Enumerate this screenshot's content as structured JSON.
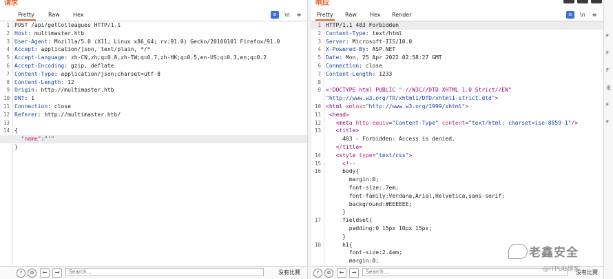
{
  "request": {
    "title": "请求",
    "tabs": [
      "Pretty",
      "Raw",
      "Hex"
    ],
    "toolbar_icons": [
      "≡",
      "\\n",
      "≡"
    ],
    "lines": [
      {
        "n": "1",
        "parts": [
          [
            "tx",
            "POST /api/getColleagues HTTP/1.1"
          ]
        ]
      },
      {
        "n": "2",
        "parts": [
          [
            "hk",
            "Host"
          ],
          [
            "tx",
            ": multimaster.htb"
          ]
        ]
      },
      {
        "n": "3",
        "parts": [
          [
            "hk",
            "User-Agent"
          ],
          [
            "tx",
            ": Mozilla/5.0 (X11; Linux x86_64; rv:91.0) Gecko/20100101 Firefox/91.0"
          ]
        ]
      },
      {
        "n": "4",
        "parts": [
          [
            "hk",
            "Accept"
          ],
          [
            "tx",
            ": application/json, text/plain, */*"
          ]
        ]
      },
      {
        "n": "5",
        "parts": [
          [
            "hk",
            "Accept-Language"
          ],
          [
            "tx",
            ": zh-CN,zh;q=0.8,zh-TW;q=0.7,zh-HK;q=0.5,en-US;q=0.3,en;q=0.2"
          ]
        ]
      },
      {
        "n": "6",
        "parts": [
          [
            "hk",
            "Accept-Encoding"
          ],
          [
            "tx",
            ": gzip, deflate"
          ]
        ]
      },
      {
        "n": "7",
        "parts": [
          [
            "hk",
            "Content-Type"
          ],
          [
            "tx",
            ": application/json;charset=utf-8"
          ]
        ]
      },
      {
        "n": "8",
        "parts": [
          [
            "hk",
            "Content-Length"
          ],
          [
            "tx",
            ": 12"
          ]
        ]
      },
      {
        "n": "9",
        "parts": [
          [
            "hk",
            "Origin"
          ],
          [
            "tx",
            ": http://multimaster.htb"
          ]
        ]
      },
      {
        "n": "10",
        "parts": [
          [
            "hk",
            "DNT"
          ],
          [
            "tx",
            ": 1"
          ]
        ]
      },
      {
        "n": "11",
        "parts": [
          [
            "hk",
            "Connection"
          ],
          [
            "tx",
            ": close"
          ]
        ]
      },
      {
        "n": "12",
        "parts": [
          [
            "hk",
            "Referer"
          ],
          [
            "tx",
            ": http://multimaster.htb/"
          ]
        ]
      },
      {
        "n": "13",
        "parts": []
      },
      {
        "n": "14",
        "parts": [
          [
            "tx",
            "{"
          ]
        ]
      },
      {
        "n": "",
        "parts": [
          [
            "tx",
            "  "
          ],
          [
            "at",
            "\"name\""
          ],
          [
            "tx",
            ":"
          ],
          [
            "av",
            "\"'\""
          ]
        ],
        "highlight": true
      },
      {
        "n": "",
        "parts": [
          [
            "tx",
            "}"
          ]
        ]
      }
    ],
    "search_placeholder": "Search...",
    "nomatch": "没有比赛"
  },
  "response": {
    "title": "响应",
    "tabs": [
      "Pretty",
      "Raw",
      "Hex",
      "Render"
    ],
    "toolbar_icons": [
      "≡",
      "\\n",
      "≡"
    ],
    "lines": [
      {
        "n": "1",
        "parts": [
          [
            "tx",
            "HTTP/1.1 403 Forbidden"
          ]
        ],
        "highlight": true
      },
      {
        "n": "2",
        "parts": [
          [
            "hk",
            "Content-Type"
          ],
          [
            "tx",
            ": text/html"
          ]
        ]
      },
      {
        "n": "3",
        "parts": [
          [
            "hk",
            "Server"
          ],
          [
            "tx",
            ": Microsoft-IIS/10.0"
          ]
        ]
      },
      {
        "n": "4",
        "parts": [
          [
            "hk",
            "X-Powered-By"
          ],
          [
            "tx",
            ": ASP.NET"
          ]
        ]
      },
      {
        "n": "5",
        "parts": [
          [
            "hk",
            "Date"
          ],
          [
            "tx",
            ": Mon, 25 Apr 2022 02:58:27 GMT"
          ]
        ]
      },
      {
        "n": "6",
        "parts": [
          [
            "hk",
            "Connection"
          ],
          [
            "tx",
            ": close"
          ]
        ]
      },
      {
        "n": "7",
        "parts": [
          [
            "hk",
            "Content-Length"
          ],
          [
            "tx",
            ": 1233"
          ]
        ]
      },
      {
        "n": "8",
        "parts": []
      },
      {
        "n": "9",
        "parts": [
          [
            "tg",
            "<!DOCTYPE html PUBLIC \"-//W3C//DTD XHTML 1.0 Strict//EN\""
          ]
        ]
      },
      {
        "n": "",
        "parts": [
          [
            "av",
            "\"http://www.w3.org/TR/xhtml1/DTD/xhtml1-strict.dtd\""
          ],
          [
            "tg",
            ">"
          ]
        ]
      },
      {
        "n": "10",
        "parts": [
          [
            "tg",
            "<html "
          ],
          [
            "at",
            "xmlns"
          ],
          [
            "tx",
            "="
          ],
          [
            "av",
            "\"http://www.w3.org/1999/xhtml\""
          ],
          [
            "tg",
            ">"
          ]
        ]
      },
      {
        "n": "11",
        "parts": [
          [
            "tg",
            " <head>"
          ]
        ]
      },
      {
        "n": "12",
        "parts": [
          [
            "tg",
            "   <meta "
          ],
          [
            "at",
            "http-equiv"
          ],
          [
            "tx",
            "="
          ],
          [
            "av",
            "\"Content-Type\""
          ],
          [
            "at",
            " content"
          ],
          [
            "tx",
            "="
          ],
          [
            "av",
            "\"text/html; charset=iso-8859-1\""
          ],
          [
            "tg",
            "/>"
          ]
        ]
      },
      {
        "n": "13",
        "parts": [
          [
            "tg",
            "   <title>"
          ]
        ]
      },
      {
        "n": "",
        "parts": [
          [
            "tx",
            "     403 - Forbidden: Access is denied."
          ]
        ]
      },
      {
        "n": "",
        "parts": [
          [
            "tg",
            "   </title>"
          ]
        ]
      },
      {
        "n": "14",
        "parts": [
          [
            "tg",
            "   <style "
          ],
          [
            "at",
            "type"
          ],
          [
            "tx",
            "="
          ],
          [
            "av",
            "\"text/css\""
          ],
          [
            "tg",
            ">"
          ]
        ]
      },
      {
        "n": "15",
        "parts": [
          [
            "tg",
            "     <!--"
          ]
        ]
      },
      {
        "n": "16",
        "parts": [
          [
            "tx",
            "     body{"
          ]
        ]
      },
      {
        "n": "",
        "parts": [
          [
            "tx",
            "       margin:0;"
          ]
        ]
      },
      {
        "n": "",
        "parts": [
          [
            "tx",
            "       font-size:.7em;"
          ]
        ]
      },
      {
        "n": "",
        "parts": [
          [
            "tx",
            "       font-family:Verdana,Arial,Helvetica,sans-serif;"
          ]
        ]
      },
      {
        "n": "",
        "parts": [
          [
            "tx",
            "       background:#EEEEEE;"
          ]
        ]
      },
      {
        "n": "",
        "parts": [
          [
            "tx",
            "     }"
          ]
        ]
      },
      {
        "n": "17",
        "parts": [
          [
            "tx",
            "     fieldset{"
          ]
        ]
      },
      {
        "n": "",
        "parts": [
          [
            "tx",
            "       padding:0 15px 10px 15px;"
          ]
        ]
      },
      {
        "n": "",
        "parts": [
          [
            "tx",
            "     }"
          ]
        ]
      },
      {
        "n": "18",
        "parts": [
          [
            "tx",
            "     h1{"
          ]
        ]
      },
      {
        "n": "",
        "parts": [
          [
            "tx",
            "       font-size:2.4em;"
          ]
        ]
      },
      {
        "n": "",
        "parts": [
          [
            "tx",
            "       margin:0;"
          ]
        ]
      }
    ],
    "search_placeholder": "Search...",
    "nomatch": "没有比赛"
  },
  "right_strip_items": [
    "F",
    "F",
    "F",
    "讯",
    "F",
    "F"
  ],
  "watermark": {
    "main": "老鑫安全",
    "sub": "@ITPUB博客"
  },
  "colors": {
    "accent": "#e8632b",
    "key": "#1a3f9c",
    "tag": "#8c0b7e",
    "attr": "#c0267a",
    "active_icon": "#3c6fd6"
  }
}
